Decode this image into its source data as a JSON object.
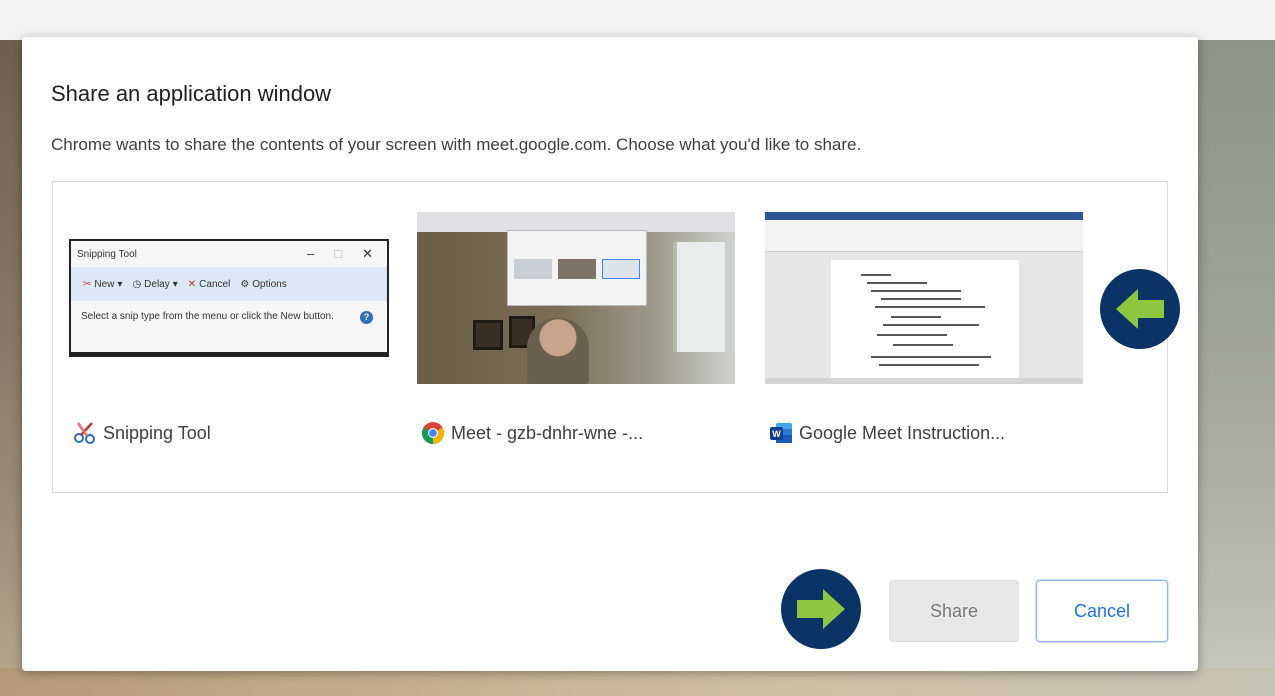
{
  "dialog": {
    "title": "Share an application window",
    "description": "Chrome wants to share the contents of your screen with meet.google.com. Choose what you'd like to share."
  },
  "sources": [
    {
      "label": "Snipping Tool",
      "icon": "scissors-icon",
      "thumbnail": {
        "window_title": "Snipping Tool",
        "toolbar": [
          "New",
          "Delay",
          "Cancel",
          "Options"
        ],
        "body_text": "Select a snip type from the menu or click the New button."
      }
    },
    {
      "label": "Meet - gzb-dnhr-wne -...",
      "icon": "chrome-icon"
    },
    {
      "label": "Google Meet Instruction...",
      "icon": "word-icon"
    }
  ],
  "buttons": {
    "share": "Share",
    "cancel": "Cancel"
  },
  "colors": {
    "marker_bg": "#0b3466",
    "marker_arrow": "#8dc63f",
    "accent": "#1a73e8"
  }
}
